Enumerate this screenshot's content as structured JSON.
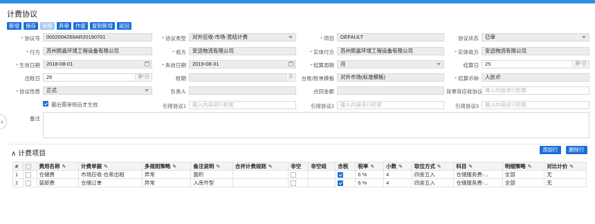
{
  "title": "计费协议",
  "toolbar": {
    "buttons": [
      "新增",
      "保存",
      "审核",
      "弃审",
      "作废",
      "复制新增",
      "返回"
    ]
  },
  "form": {
    "r1": [
      {
        "label": "协议号",
        "req": true,
        "value": "0002004269AR20190701"
      },
      {
        "label": "协议类型",
        "req": true,
        "value": "对外应收-市场-竞结计费"
      },
      {
        "label": "项目",
        "req": true,
        "value": "DEFAULT"
      },
      {
        "label": "协议状态",
        "req": false,
        "value": "已审"
      }
    ],
    "r2": [
      {
        "label": "付方",
        "req": true,
        "value": "苏州熙嘉环境工程设备有限公司"
      },
      {
        "label": "收方",
        "req": true,
        "value": "安迅物流有限公司"
      },
      {
        "label": "实体付方",
        "req": true,
        "value": "苏州熙嘉环境工程设备有限公司"
      },
      {
        "label": "实体收方",
        "req": true,
        "value": "安迅物流有限公司"
      }
    ],
    "r3": [
      {
        "label": "生效日期",
        "req": true,
        "value": "2018-08-01"
      },
      {
        "label": "失效日期",
        "req": true,
        "value": "2019-08-31"
      },
      {
        "label": "结算周期",
        "req": true,
        "value": "月"
      },
      {
        "label": "结算日",
        "req": false,
        "value": "25",
        "suffix": "第*日"
      }
    ],
    "r4": [
      {
        "label": "出账日",
        "req": false,
        "value": "26",
        "suffix": "第*日"
      },
      {
        "label": "账期",
        "req": false,
        "value": "",
        "suffix": "天"
      },
      {
        "label": "台账/账单模板",
        "req": false,
        "value": "对外市场(标准模板)"
      },
      {
        "label": "结算币种",
        "req": true,
        "value": "人民币"
      }
    ],
    "r5": [
      {
        "label": "协议性质",
        "req": true,
        "value": "正式"
      },
      {
        "label": "负责人",
        "req": false,
        "value": ""
      },
      {
        "label": "合同金额",
        "req": false,
        "value": ""
      },
      {
        "label": "背靠背应收协议",
        "req": false,
        "value": "",
        "placeholder": "输入内容进行检索"
      }
    ],
    "checkbox_label": "最后需审核后才生效",
    "r6": [
      {
        "label": "引用协议1",
        "placeholder": "输入内容进行检索"
      },
      {
        "label": "引用协议2",
        "placeholder": "输入内容进行检索"
      },
      {
        "label": "引用协议3",
        "placeholder": "输入内容进行检索"
      }
    ],
    "remark_label": "备注"
  },
  "section": {
    "title": "计费项目",
    "add": "添加行",
    "del": "删除行"
  },
  "table": {
    "headers": [
      "#",
      "",
      "费用名称",
      "计费单据",
      "多规则策略",
      "备注说明",
      "合并计费规则",
      "非空",
      "非空组",
      "含税",
      "税率",
      "小数",
      "取位方式",
      "科目",
      "明细策略",
      "对比计价"
    ],
    "rows": [
      [
        "1",
        "",
        "仓储费",
        "市场应收-仓库出租",
        "异常",
        "面积",
        "",
        "",
        "",
        "on",
        "6 %",
        "4",
        "四舍五入",
        "仓储服务费-...",
        "全部",
        "无"
      ],
      [
        "2",
        "",
        "装卸费",
        "仓储订单",
        "异常",
        "入库件型",
        "",
        "",
        "",
        "on",
        "6 %",
        "4",
        "四舍五入",
        "仓储服务费-...",
        "全部",
        "无"
      ]
    ]
  }
}
